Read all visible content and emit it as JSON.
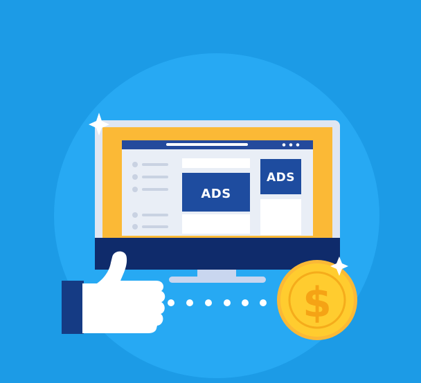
{
  "ads": {
    "main_banner_label": "ADS",
    "side_banner_label": "ADS"
  },
  "coin": {
    "symbol": "$"
  },
  "colors": {
    "background": "#1c9be6",
    "circle": "#27a9f3",
    "monitor_frame": "#0f2b6b",
    "monitor_bezel": "#c9d6ef",
    "screen_border": "#fbb936",
    "browser_bar": "#244a9c",
    "ad_blue": "#1e4c9f",
    "coin": "#ffcc2f",
    "hand": "#ffffff",
    "cuff": "#153b84"
  },
  "icons": [
    "thumbs-up-icon",
    "dollar-coin-icon",
    "sparkle-icon",
    "monitor-icon"
  ]
}
